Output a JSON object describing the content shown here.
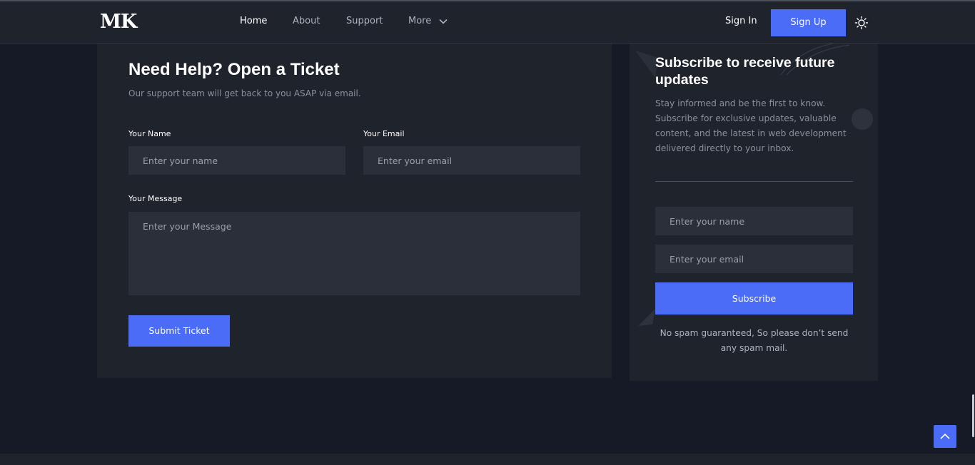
{
  "header": {
    "logo": "MK",
    "nav": [
      {
        "label": "Home"
      },
      {
        "label": "About"
      },
      {
        "label": "Support"
      },
      {
        "label": "More"
      }
    ],
    "sign_in": "Sign In",
    "sign_up": "Sign Up"
  },
  "ticket": {
    "title": "Need Help? Open a Ticket",
    "subtitle": "Our support team will get back to you ASAP via email.",
    "name_label": "Your Name",
    "name_placeholder": "Enter your name",
    "email_label": "Your Email",
    "email_placeholder": "Enter your email",
    "message_label": "Your Message",
    "message_placeholder": "Enter your Message",
    "submit_label": "Submit Ticket"
  },
  "subscribe": {
    "title": "Subscribe to receive future updates",
    "description": "Stay informed and be the first to know. Subscribe for exclusive updates, valuable content, and the latest in web development delivered directly to your inbox.",
    "name_placeholder": "Enter your name",
    "email_placeholder": "Enter your email",
    "button_label": "Subscribe",
    "note": "No spam guaranteed, So please don’t send any spam mail."
  },
  "colors": {
    "accent": "#4a6cf7",
    "page_bg": "#151a26",
    "card_bg": "#1f232c",
    "input_bg": "#2b2f3a"
  },
  "icons": {
    "nav_more": "chevron-down-icon",
    "theme_toggle": "sun-icon",
    "back_to_top": "chevron-up-icon"
  }
}
